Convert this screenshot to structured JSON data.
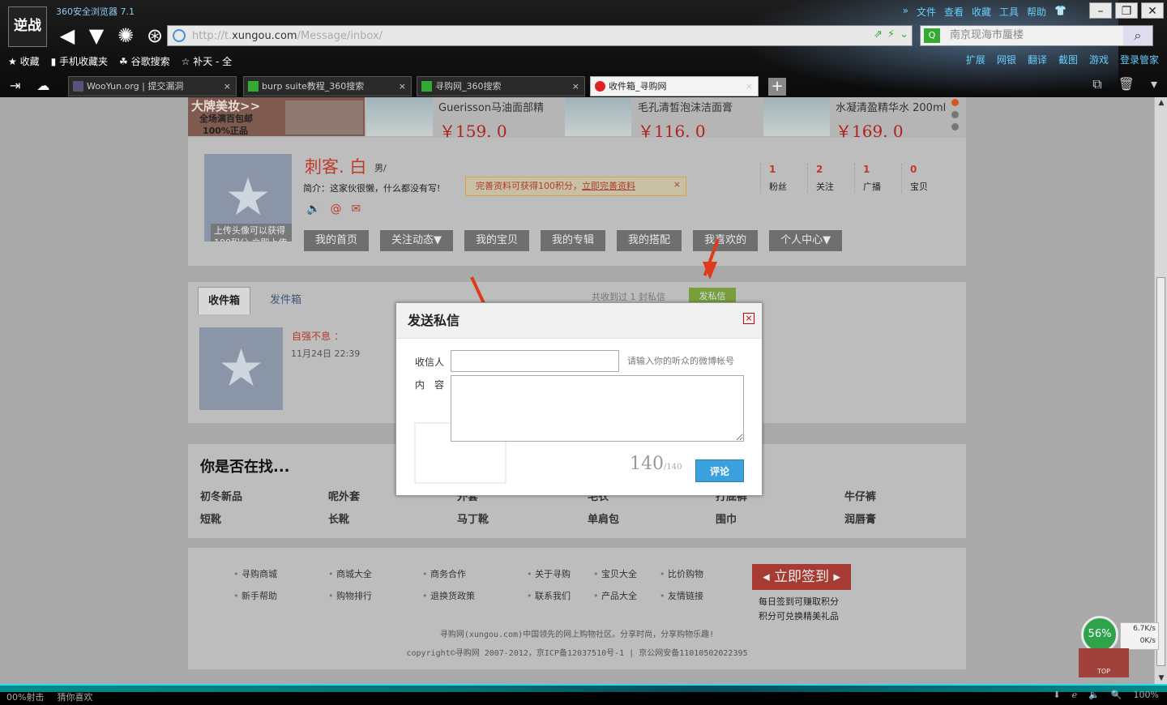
{
  "browser": {
    "title": "360安全浏览器 7.1",
    "logo_text": "逆战",
    "menu": [
      "文件",
      "查看",
      "收藏",
      "工具",
      "帮助"
    ],
    "address": {
      "prefix": "http://t.",
      "domain": "xungou.com",
      "path": "/Message/inbox/"
    },
    "search_placeholder": "南京现海市蜃楼",
    "bookmarks": [
      "收藏",
      "手机收藏夹",
      "谷歌搜索",
      "补天 - 全"
    ],
    "toolbar_right": [
      "扩展",
      "网银",
      "翻译",
      "截图",
      "游戏",
      "登录管家"
    ],
    "tabs": [
      {
        "label": "WooYun.org | 提交漏洞"
      },
      {
        "label": "burp suite教程_360搜索"
      },
      {
        "label": "寻购网_360搜索"
      },
      {
        "label": "收件箱_寻购网",
        "active": true
      }
    ]
  },
  "banner": {
    "promo_line1": "大牌美妆>>",
    "promo_line2": "全场满百包邮",
    "promo_line3": "100%正品",
    "products": [
      {
        "name": "Guerisson马油面部精",
        "price": "￥159. 0"
      },
      {
        "name": "毛孔清皙泡沫洁面膏",
        "price": "￥116. 0"
      },
      {
        "name": "水凝清盈精华水 200ml",
        "price": "￥169. 0"
      }
    ]
  },
  "profile": {
    "avatar_tip": "上传头像可以获得100积分 立即上传",
    "nickname": "刺客. 白",
    "gender": "男/",
    "intro": "简介：这家伙很懒，什么都没有写!",
    "hint_text": "完善资料可获得100积分，",
    "hint_link": "立即完善资料",
    "hint_close": "×",
    "stats": [
      {
        "value": "1",
        "label": "粉丝"
      },
      {
        "value": "2",
        "label": "关注"
      },
      {
        "value": "1",
        "label": "广播"
      },
      {
        "value": "0",
        "label": "宝贝"
      }
    ],
    "nav": [
      "我的首页",
      "关注动态▼",
      "我的宝贝",
      "我的专辑",
      "我的搭配",
      "我喜欢的",
      "个人中心▼"
    ]
  },
  "inbox": {
    "tab_inbox": "收件箱",
    "tab_outbox": "发件箱",
    "count_text": "共收到过 1 封私信",
    "send_button": "发私信",
    "message": {
      "sender": "自强不息 ：",
      "time": "11月24日 22:39"
    }
  },
  "find": {
    "title": "你是否在找...",
    "row1": [
      "初冬新品",
      "呢外套",
      "外套",
      "毛衣",
      "打底裤",
      "牛仔裤"
    ],
    "row2": [
      "短靴",
      "长靴",
      "马丁靴",
      "单肩包",
      "围巾",
      "润唇膏"
    ]
  },
  "footer": {
    "links_row1": [
      "寻购商城",
      "商城大全",
      "商务合作",
      "关于寻购",
      "宝贝大全",
      "比价购物"
    ],
    "links_row2": [
      "新手帮助",
      "购物排行",
      "退换货政策",
      "联系我们",
      "产品大全",
      "友情链接"
    ],
    "signin_label": "立即签到",
    "signin_line1": "每日签到可赚取积分",
    "signin_line2": "积分可兑换精美礼品",
    "slogan": "寻购网(xungou.com)中国领先的网上购物社区。分享时尚，分享购物乐趣!",
    "copyright": "copyright©寻购网 2007-2012，京ICP备12037510号-1 | 京公网安备11010502022395"
  },
  "dialog": {
    "title": "发送私信",
    "close": "×",
    "recipient_label": "收信人",
    "recipient_hint": "请输入你的听众的微博帐号",
    "content_label": "内　容",
    "count_big": "140",
    "count_small": "/140",
    "submit": "评论"
  },
  "widget": {
    "percent": "56%",
    "up": "6.7K/s",
    "down": "0K/s",
    "top_label": "TOP"
  },
  "statusbar": {
    "left1": "00%射击",
    "left2": "猜你喜欢",
    "zoom": "100%"
  }
}
